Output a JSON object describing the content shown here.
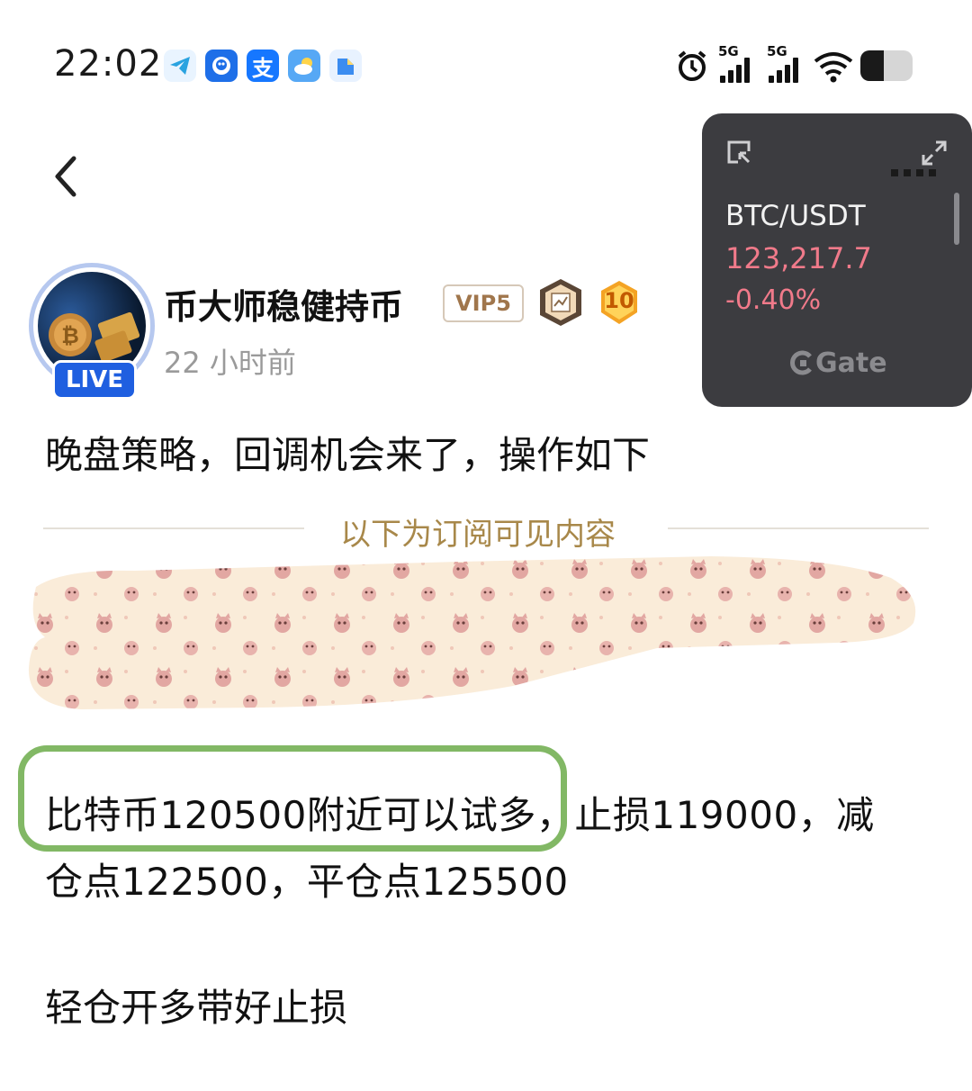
{
  "status_bar": {
    "time": "22:02",
    "apps": [
      "telegram-icon",
      "baidu-disk-icon",
      "alipay-icon",
      "weather-icon",
      "cloud-doc-icon"
    ],
    "alipay_glyph": "支",
    "network_1": "5G",
    "network_2": "5G",
    "alarm_icon": "alarm-icon",
    "wifi_icon": "wifi-icon",
    "battery_level": 0.45
  },
  "header": {
    "back_icon": "chevron-left-icon",
    "author_name": "币大师稳健持币",
    "vip_badge": "VIP5",
    "level_badge": "10",
    "live_badge": "LIVE",
    "post_time": "22 小时前"
  },
  "price_widget": {
    "pair": "BTC/USDT",
    "price": "123,217.7",
    "change": "-0.40%",
    "brand": "Gate",
    "colors": {
      "down": "#f07a8a",
      "bg": "#3c3c40"
    }
  },
  "post": {
    "headline": "晚盘策略，回调机会来了，操作如下",
    "subscriber_divider": "以下为订阅可见内容",
    "line1_highlight": "比特币120500附近可以试多",
    "line1_rest": "，止损119000，减",
    "line2": "仓点122500，平仓点125500",
    "line3": "轻仓开多带好止损"
  },
  "colors": {
    "highlight_border": "#82b865",
    "accent_blue": "#1f5fe0",
    "divider_text": "#a8884a"
  }
}
